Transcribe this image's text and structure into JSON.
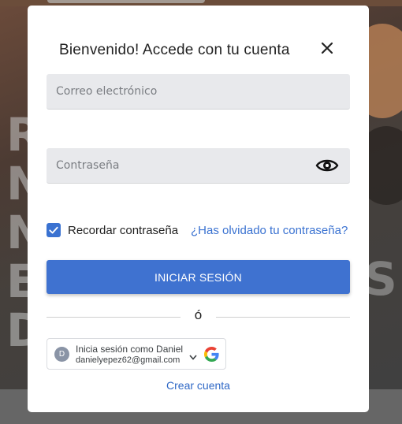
{
  "background": {
    "letters": [
      "R",
      "N",
      "N",
      "E",
      "D"
    ],
    "right_letter": "S"
  },
  "modal": {
    "title": "Bienvenido! Accede con tu cuenta",
    "close_icon": "close-icon"
  },
  "form": {
    "email_placeholder": "Correo electrónico",
    "email_value": "",
    "password_placeholder": "Contraseña",
    "password_value": "",
    "show_password_icon": "eye-icon",
    "remember_label": "Recordar contraseña",
    "remember_checked": true,
    "forgot_label": "¿Has olvidado tu contraseña?",
    "login_label": "INICIAR SESIÓN",
    "divider_label": "ó"
  },
  "google": {
    "avatar_initial": "D",
    "name_label": "Inicia sesión como Daniel",
    "email": "danielyepez62@gmail.com"
  },
  "footer": {
    "create_account_label": "Crear cuenta"
  },
  "colors": {
    "accent": "#3f72d0",
    "link": "#3a72d1",
    "field_bg": "#e8e9ec"
  }
}
